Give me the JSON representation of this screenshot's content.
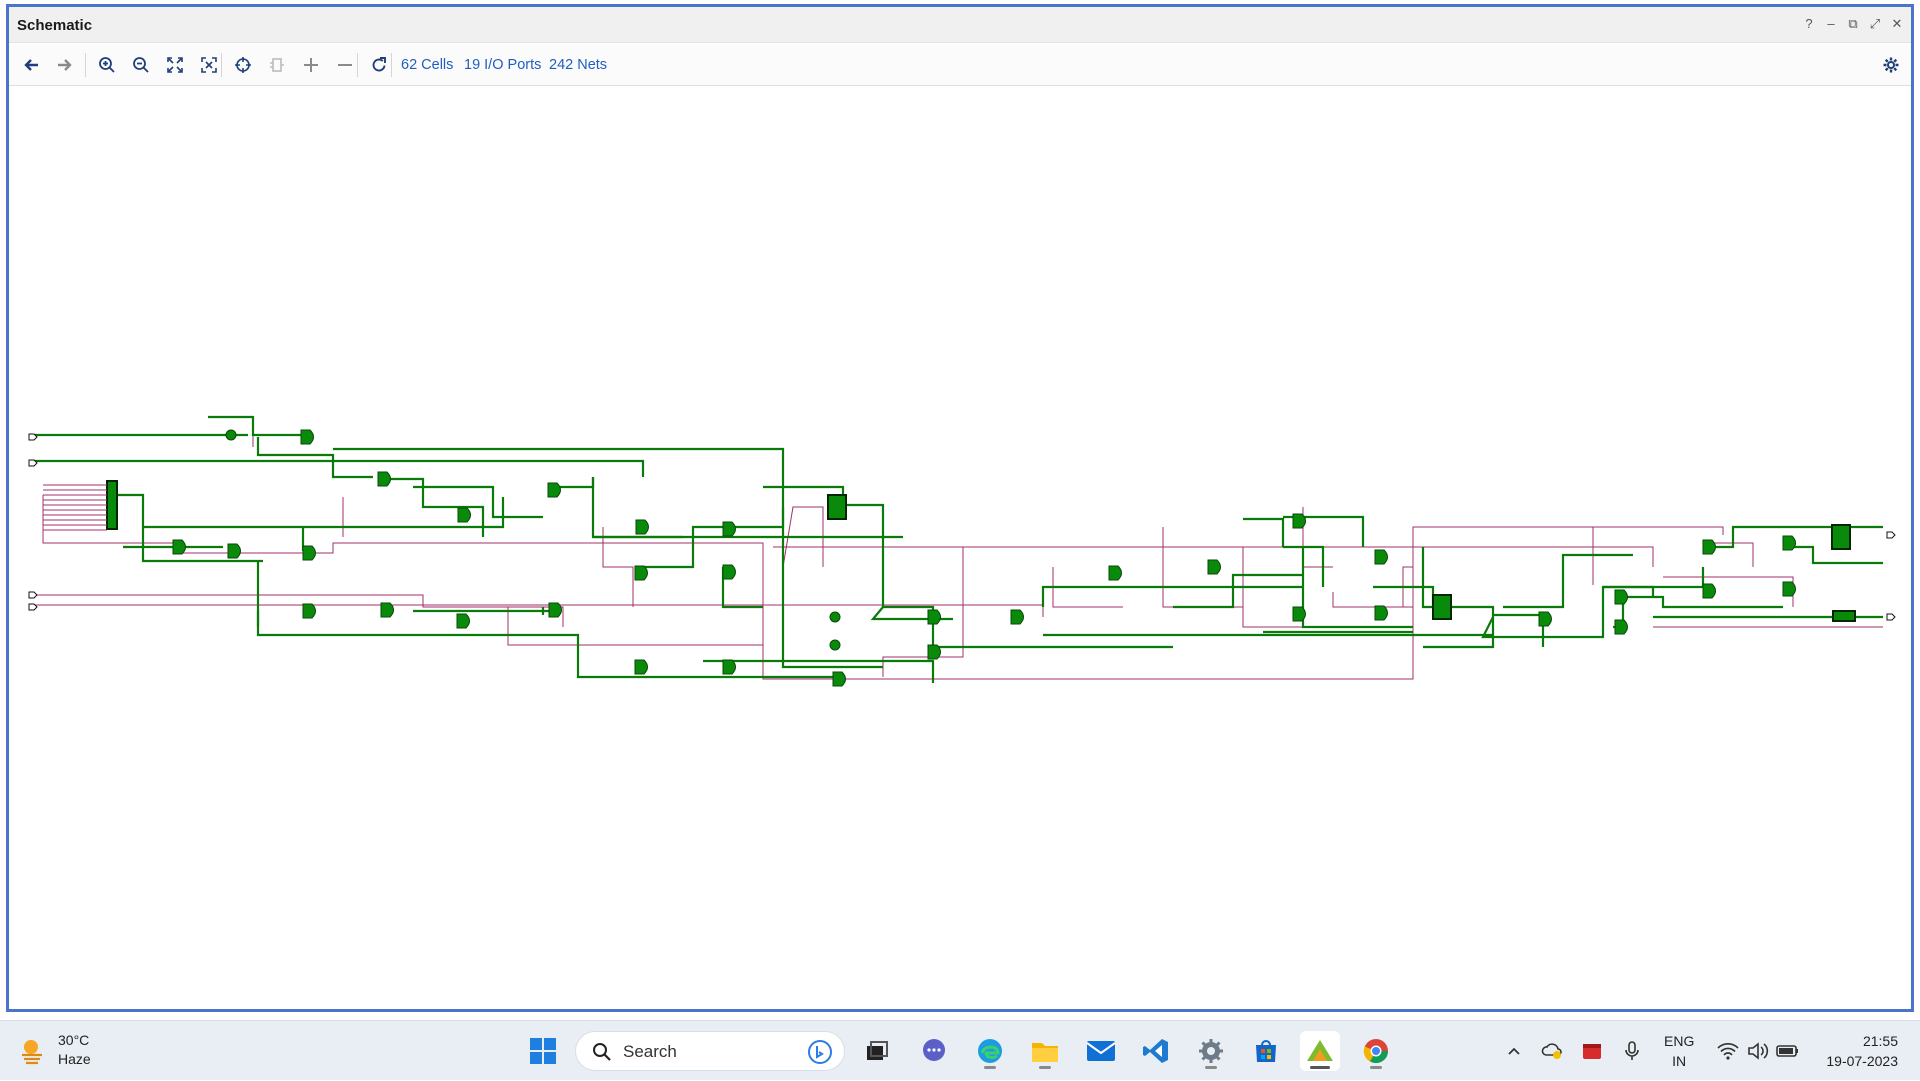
{
  "window": {
    "title": "Schematic"
  },
  "window_controls": [
    "?",
    "–",
    "⧉",
    "⤢",
    "✕"
  ],
  "toolbar": {
    "buttons": [
      "back",
      "forward",
      "zoom-in",
      "zoom-out",
      "fit",
      "zoom-fit-selection",
      "crosshair",
      "regenerate",
      "expand",
      "collapse",
      "refresh"
    ],
    "stats": {
      "cells": "62 Cells",
      "ports": "19 I/O Ports",
      "nets": "242 Nets"
    },
    "settings": "gear"
  },
  "colors": {
    "net_green": "#0a7a0a",
    "cell_fill": "#0a8a0a",
    "net_purple": "#a0306a",
    "accent": "#1f5fbf",
    "window_border": "#4a74c9"
  },
  "taskbar": {
    "weather": {
      "temp": "30°C",
      "condition": "Haze"
    },
    "search_label": "Search",
    "apps": [
      "windows-start",
      "task-view",
      "chat",
      "edge",
      "file-explorer",
      "mail",
      "vscode",
      "settings",
      "store",
      "vivado",
      "chrome"
    ],
    "language": {
      "line1": "ENG",
      "line2": "IN"
    },
    "clock": {
      "time": "21:55",
      "date": "19-07-2023"
    }
  }
}
